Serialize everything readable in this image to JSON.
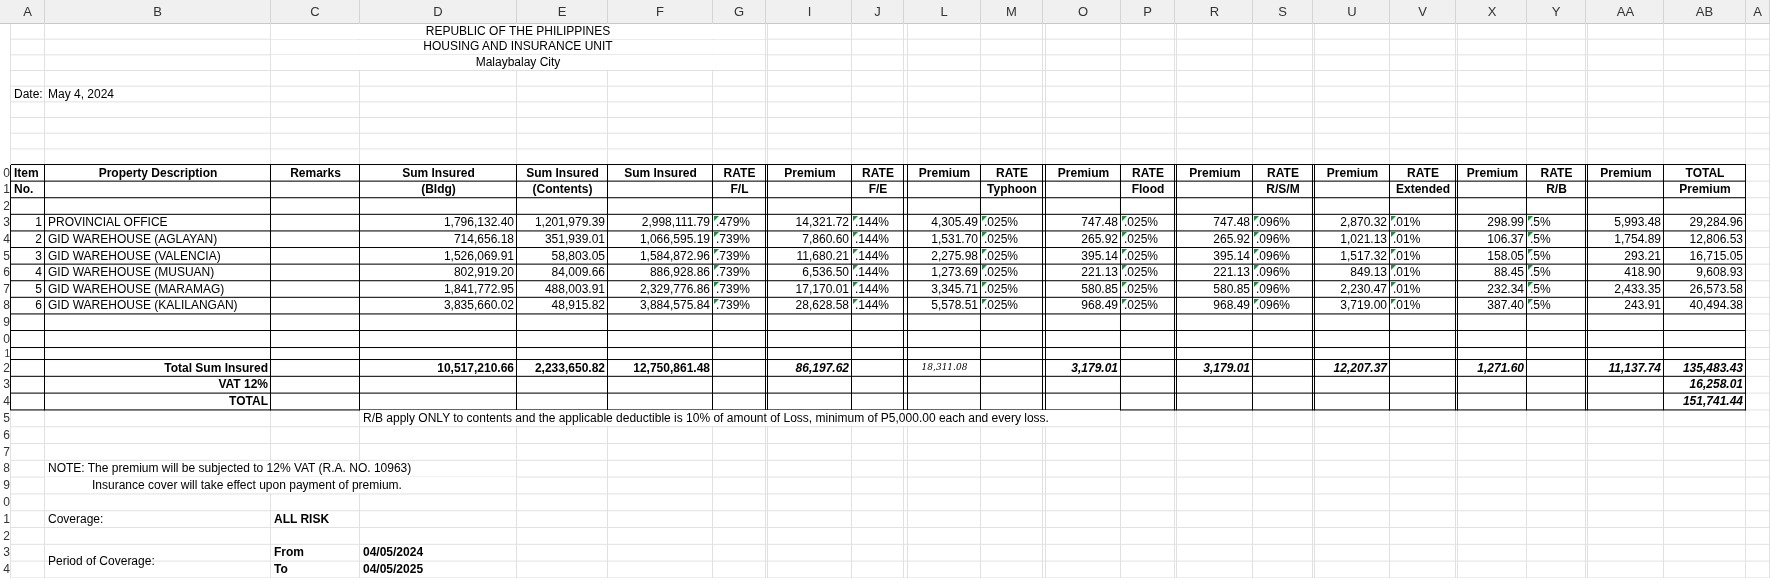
{
  "column_headers": [
    "A",
    "B",
    "C",
    "D",
    "E",
    "F",
    "G",
    "I",
    "J",
    "L",
    "M",
    "O",
    "P",
    "R",
    "S",
    "U",
    "V",
    "X",
    "Y",
    "AA",
    "AB",
    "A"
  ],
  "row_numbers": [
    "0",
    "1",
    "2",
    "3",
    "4",
    "5",
    "6",
    "7",
    "8",
    "9",
    "0",
    "1",
    "2",
    "3",
    "4",
    "5",
    "6",
    "7",
    "8",
    "9",
    "0",
    "1",
    "2",
    "3",
    "4"
  ],
  "letterhead": [
    "REPUBLIC OF THE PHILIPPINES",
    "HOUSING AND INSURANCE UNIT",
    "Malaybalay City"
  ],
  "date": {
    "label": "Date:",
    "value": "May 4, 2024"
  },
  "table": {
    "headers": [
      {
        "top": "Item",
        "bottom": "No."
      },
      {
        "top": "Property Description"
      },
      {
        "top": "Remarks"
      },
      {
        "top": "Sum Insured",
        "bottom": "(Bldg)"
      },
      {
        "top": "Sum Insured",
        "bottom": "(Contents)"
      },
      {
        "top": "Sum Insured"
      },
      {
        "top": "RATE",
        "bottom": "F/L"
      },
      {
        "top": "Premium"
      },
      {
        "top": "RATE",
        "bottom": "F/E"
      },
      {
        "top": "Premium"
      },
      {
        "top": "RATE",
        "bottom": "Typhoon"
      },
      {
        "top": "Premium"
      },
      {
        "top": "RATE",
        "bottom": "Flood"
      },
      {
        "top": "Premium"
      },
      {
        "top": "RATE",
        "bottom": "R/S/M"
      },
      {
        "top": "Premium"
      },
      {
        "top": "RATE",
        "bottom": "Extended"
      },
      {
        "top": "Premium"
      },
      {
        "top": "RATE",
        "bottom": "R/B"
      },
      {
        "top": "Premium"
      },
      {
        "top": "TOTAL",
        "bottom": "Premium"
      }
    ],
    "rows": [
      {
        "item": "1",
        "description": "PROVINCIAL OFFICE",
        "sums": [
          "1,796,132.40",
          "1,201,979.39",
          "2,998,111.79"
        ],
        "rates": [
          {
            "rate": ".479%",
            "flagged": true,
            "premium": "14,321.72"
          },
          {
            "rate": ".144%",
            "flagged": true,
            "premium": "4,305.49"
          },
          {
            "rate": ".025%",
            "flagged": true,
            "premium": "747.48"
          },
          {
            "rate": ".025%",
            "flagged": true,
            "premium": "747.48"
          },
          {
            "rate": ".096%",
            "flagged": true,
            "premium": "2,870.32"
          },
          {
            "rate": ".01%",
            "flagged": true,
            "premium": "298.99"
          },
          {
            "rate": ".5%",
            "flagged": true,
            "premium": "5,993.48"
          }
        ],
        "total": "29,284.96"
      },
      {
        "item": "2",
        "description": "GID WAREHOUSE (AGLAYAN)",
        "sums": [
          "714,656.18",
          "351,939.01",
          "1,066,595.19"
        ],
        "rates": [
          {
            "rate": ".739%",
            "flagged": true,
            "premium": "7,860.60"
          },
          {
            "rate": ".144%",
            "flagged": true,
            "premium": "1,531.70"
          },
          {
            "rate": ".025%",
            "flagged": true,
            "premium": "265.92"
          },
          {
            "rate": ".025%",
            "flagged": true,
            "premium": "265.92"
          },
          {
            "rate": ".096%",
            "flagged": true,
            "premium": "1,021.13"
          },
          {
            "rate": ".01%",
            "flagged": true,
            "premium": "106.37"
          },
          {
            "rate": ".5%",
            "flagged": true,
            "premium": "1,754.89"
          }
        ],
        "total": "12,806.53"
      },
      {
        "item": "3",
        "description": "GID WAREHOUSE (VALENCIA)",
        "sums": [
          "1,526,069.91",
          "58,803.05",
          "1,584,872.96"
        ],
        "rates": [
          {
            "rate": ".739%",
            "flagged": true,
            "premium": "11,680.21"
          },
          {
            "rate": ".144%",
            "flagged": true,
            "premium": "2,275.98"
          },
          {
            "rate": ".025%",
            "flagged": true,
            "premium": "395.14"
          },
          {
            "rate": ".025%",
            "flagged": true,
            "premium": "395.14"
          },
          {
            "rate": ".096%",
            "flagged": true,
            "premium": "1,517.32"
          },
          {
            "rate": ".01%",
            "flagged": true,
            "premium": "158.05"
          },
          {
            "rate": ".5%",
            "flagged": true,
            "premium": "293.21"
          }
        ],
        "total": "16,715.05"
      },
      {
        "item": "4",
        "description": "GID WAREHOUSE (MUSUAN)",
        "sums": [
          "802,919.20",
          "84,009.66",
          "886,928.86"
        ],
        "rates": [
          {
            "rate": ".739%",
            "flagged": true,
            "premium": "6,536.50"
          },
          {
            "rate": ".144%",
            "flagged": true,
            "premium": "1,273.69"
          },
          {
            "rate": ".025%",
            "flagged": true,
            "premium": "221.13"
          },
          {
            "rate": ".025%",
            "flagged": true,
            "premium": "221.13"
          },
          {
            "rate": ".096%",
            "flagged": true,
            "premium": "849.13"
          },
          {
            "rate": ".01%",
            "flagged": true,
            "premium": "88.45"
          },
          {
            "rate": ".5%",
            "flagged": true,
            "premium": "418.90"
          }
        ],
        "total": "9,608.93"
      },
      {
        "item": "5",
        "description": "GID WAREHOUSE (MARAMAG)",
        "sums": [
          "1,841,772.95",
          "488,003.91",
          "2,329,776.86"
        ],
        "rates": [
          {
            "rate": ".739%",
            "flagged": true,
            "premium": "17,170.01"
          },
          {
            "rate": ".144%",
            "flagged": true,
            "premium": "3,345.71"
          },
          {
            "rate": ".025%",
            "flagged": true,
            "premium": "580.85"
          },
          {
            "rate": ".025%",
            "flagged": true,
            "premium": "580.85"
          },
          {
            "rate": ".096%",
            "flagged": true,
            "premium": "2,230.47"
          },
          {
            "rate": ".01%",
            "flagged": true,
            "premium": "232.34"
          },
          {
            "rate": ".5%",
            "flagged": true,
            "premium": "2,433.35"
          }
        ],
        "total": "26,573.58"
      },
      {
        "item": "6",
        "description": "GID WAREHOUSE (KALILANGAN)",
        "sums": [
          "3,835,660.02",
          "48,915.82",
          "3,884,575.84"
        ],
        "rates": [
          {
            "rate": ".739%",
            "flagged": true,
            "premium": "28,628.58"
          },
          {
            "rate": ".144%",
            "flagged": true,
            "premium": "5,578.51"
          },
          {
            "rate": ".025%",
            "flagged": true,
            "premium": "968.49"
          },
          {
            "rate": ".025%",
            "flagged": true,
            "premium": "968.49"
          },
          {
            "rate": ".096%",
            "flagged": true,
            "premium": "3,719.00"
          },
          {
            "rate": ".01%",
            "flagged": true,
            "premium": "387.40"
          },
          {
            "rate": ".5%",
            "flagged": true,
            "premium": "243.91"
          }
        ],
        "total": "40,494.38"
      }
    ],
    "totals": [
      {
        "label": "Total Sum Insured",
        "sums": [
          "10,517,210.66",
          "2,233,650.82",
          "12,750,861.48"
        ],
        "premiums": [
          "86,197.62",
          "18,311.08",
          "3,179.01",
          "3,179.01",
          "12,207.37",
          "1,271.60",
          "11,137.74"
        ],
        "total": "135,483.43"
      },
      {
        "label": "VAT 12%",
        "total": "16,258.01"
      },
      {
        "label": "TOTAL",
        "total": "151,741.44"
      }
    ],
    "footnote": "R/B apply ONLY to contents and the applicable deductible is 10% of amount of Loss, minimum of P5,000.00 each and every loss."
  },
  "note": [
    "NOTE: The premium will be subjected to 12% VAT (R.A. NO. 10963)",
    "Insurance cover will take effect upon payment of premium."
  ],
  "coverage": {
    "label": "Coverage:",
    "value": "ALL RISK"
  },
  "period": {
    "label": "Period of Coverage:",
    "from_label": "From",
    "from": "04/05/2024",
    "to_label": "To",
    "to": "04/05/2025"
  }
}
